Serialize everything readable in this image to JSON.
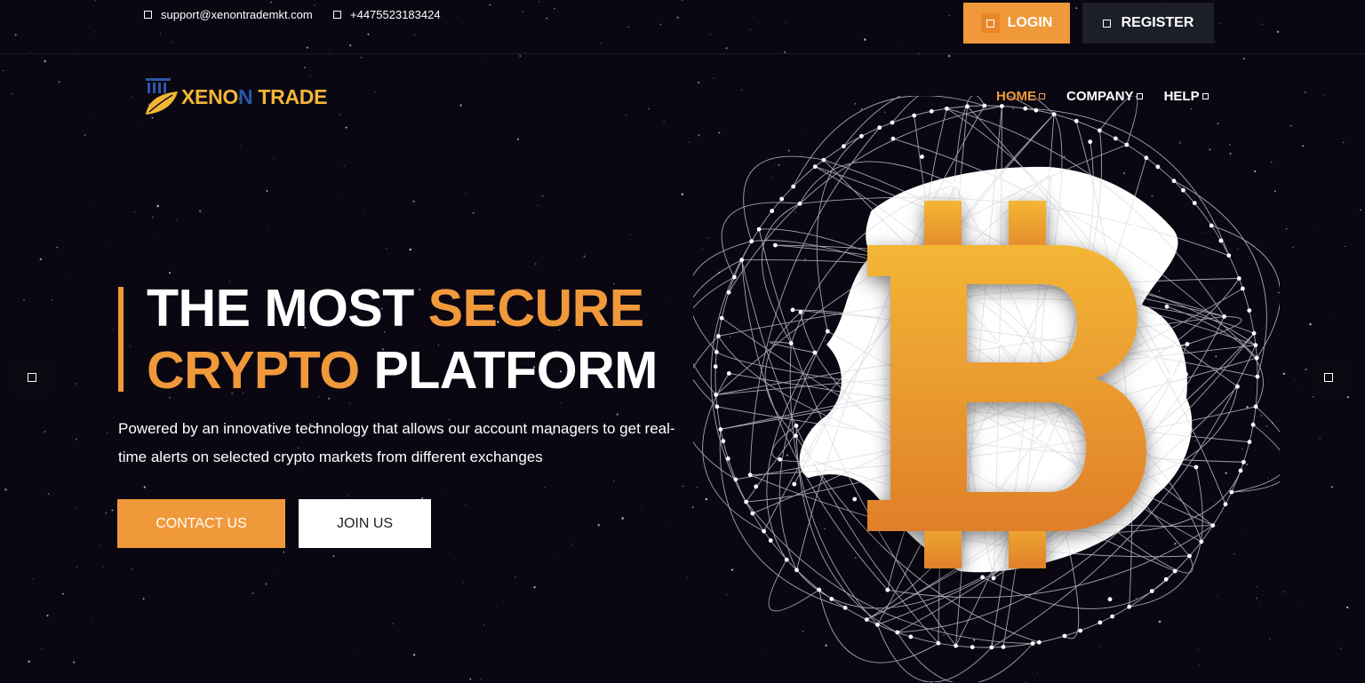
{
  "topbar": {
    "email": "support@xenontrademkt.com",
    "phone": "+4475523183424",
    "login_label": "LOGIN",
    "register_label": "REGISTER"
  },
  "logo": {
    "part1": "XENO",
    "part2": "N",
    "part3": " TRADE"
  },
  "nav": {
    "items": [
      {
        "label": "HOME",
        "active": true
      },
      {
        "label": "COMPANY",
        "active": false
      },
      {
        "label": "HELP",
        "active": false
      }
    ]
  },
  "hero": {
    "title_line1_white": "THE MOST",
    "title_line1_orange": "SECURE",
    "title_line2_orange": "CRYPTO",
    "title_line2_white": "PLATFORM",
    "description": "Powered by an innovative technology that allows our account managers to get real-time alerts on selected crypto markets from different exchanges",
    "contact_label": "CONTACT US",
    "join_label": "JOIN US"
  },
  "colors": {
    "accent": "#f0993a",
    "background": "#0a0712",
    "logo_yellow": "#f3b634",
    "logo_blue": "#2a57a8"
  }
}
